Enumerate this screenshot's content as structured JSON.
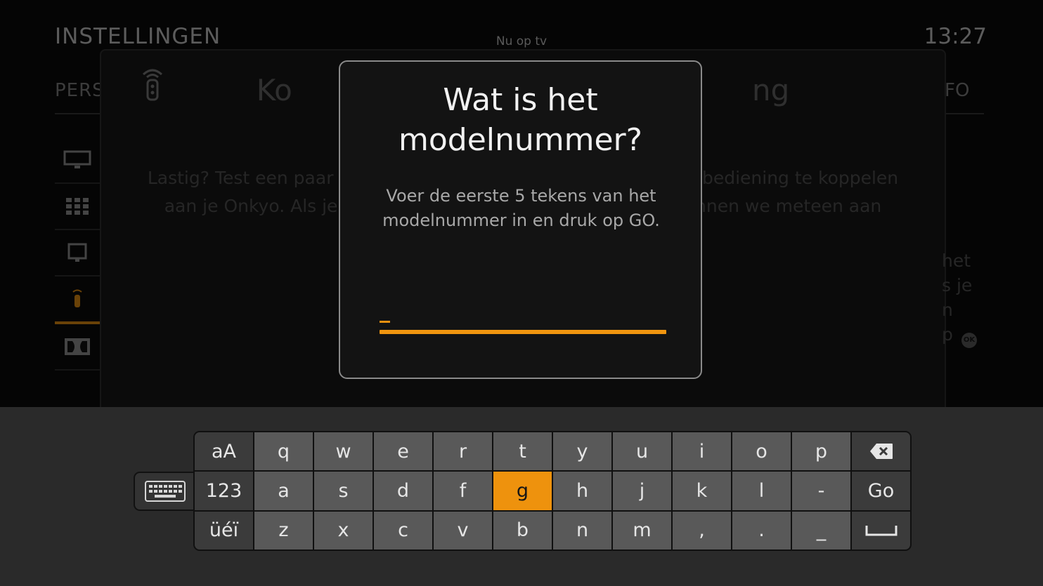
{
  "header": {
    "title": "INSTELLINGEN",
    "now": "Nu op tv",
    "clock": "13:27"
  },
  "tabs": {
    "left": "PERS",
    "right": "FO"
  },
  "panel": {
    "title": "Ko                                                 ng",
    "text": "Lastig? Test een paar                                                                  bediening te koppelen aan je Onkyo. Als je                                                                nnen we meteen aan",
    "side_lines": [
      "het",
      "s je",
      "n",
      "p"
    ],
    "ok_label": "OK"
  },
  "dialog": {
    "title": "Wat is het modelnummer?",
    "body": "Voer de eerste 5 tekens van het modelnummer in en druk op GO.",
    "value": ""
  },
  "keyboard": {
    "rows": [
      [
        "aA",
        "q",
        "w",
        "e",
        "r",
        "t",
        "y",
        "u",
        "i",
        "o",
        "p",
        "⌫"
      ],
      [
        "123",
        "a",
        "s",
        "d",
        "f",
        "g",
        "h",
        "j",
        "k",
        "l",
        "-",
        "Go"
      ],
      [
        "üéï",
        "z",
        "x",
        "c",
        "v",
        "b",
        "n",
        "m",
        ",",
        ".",
        "_",
        "␣"
      ]
    ],
    "selected": "g",
    "colors": {
      "accent": "#ee920d",
      "key": "#595959",
      "function_key": "#3b3b3b"
    }
  },
  "icons": {
    "remote": "remote-signal-icon",
    "keyboard_toggle": "keyboard-icon",
    "backspace": "backspace-icon",
    "space": "space-icon"
  }
}
